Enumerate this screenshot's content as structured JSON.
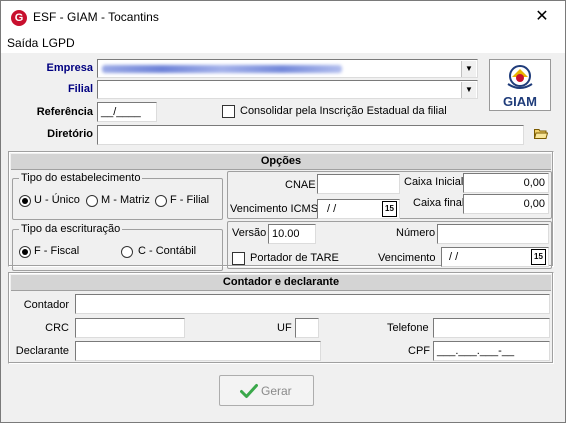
{
  "window": {
    "title": "ESF - GIAM - Tocantins",
    "app_icon_letter": "G"
  },
  "menu": {
    "items": [
      "Saída",
      "LGPD"
    ]
  },
  "header_fields": {
    "empresa_label": "Empresa",
    "filial_label": "Filial",
    "referencia_label": "Referência",
    "referencia_value": "__/____",
    "consolidar_label": "Consolidar pela Inscrição Estadual da filial",
    "diretorio_label": "Diretório",
    "diretorio_value": ""
  },
  "logo": {
    "text": "GIAM"
  },
  "opcoes": {
    "header": "Opções",
    "tipo_estabelecimento": {
      "title": "Tipo do estabelecimento",
      "options": [
        "U - Único",
        "M - Matriz",
        "F - Filial"
      ],
      "selected": "U - Único"
    },
    "tipo_escrituracao": {
      "title": "Tipo da escrituração",
      "options": [
        "F - Fiscal",
        "C - Contábil"
      ],
      "selected": "F - Fiscal"
    },
    "cnae_label": "CNAE",
    "cnae_value": "",
    "caixa_inicial_label": "Caixa Inicial",
    "caixa_inicial_value": "0,00",
    "vencimento_icms_label": "Vencimento ICMS",
    "vencimento_icms_value": "/  /",
    "caixa_final_label": "Caixa final",
    "caixa_final_value": "0,00",
    "versao_label": "Versão",
    "versao_value": "10.00",
    "numero_label": "Número",
    "numero_value": "",
    "portador_tare_label": "Portador de TARE",
    "vencimento_label": "Vencimento",
    "vencimento_value": "/  /",
    "calendar_icon_text": "15"
  },
  "contador": {
    "header": "Contador e declarante",
    "contador_label": "Contador",
    "crc_label": "CRC",
    "uf_label": "UF",
    "telefone_label": "Telefone",
    "declarante_label": "Declarante",
    "cpf_label": "CPF",
    "cpf_value": "___.___.___-__"
  },
  "actions": {
    "gerar_label": "Gerar"
  },
  "colors": {
    "label_navy": "#000080",
    "accent_green": "#3aa84a",
    "logo_blue": "#1f3c7a"
  }
}
